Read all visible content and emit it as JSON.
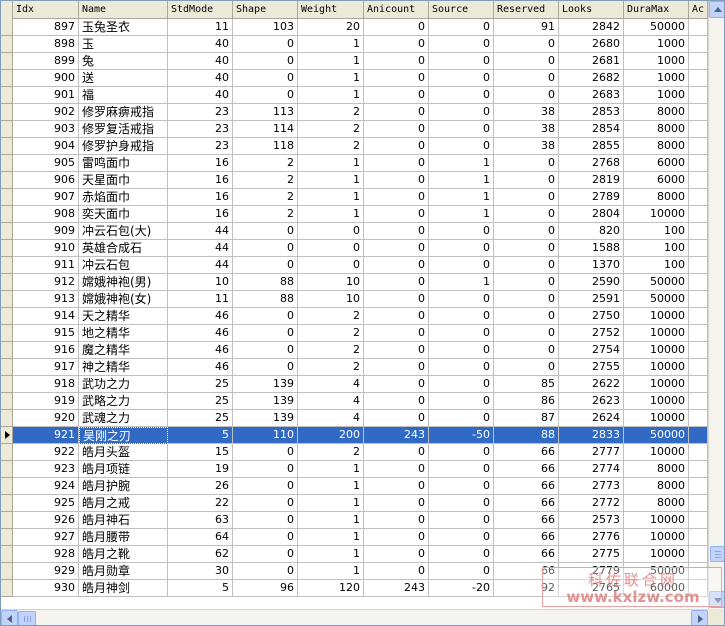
{
  "columns": [
    "Idx",
    "Name",
    "StdMode",
    "Shape",
    "Weight",
    "Anicount",
    "Source",
    "Reserved",
    "Looks",
    "DuraMax",
    "Ac"
  ],
  "selected_idx": "921",
  "rows": [
    [
      "897",
      "玉兔圣衣",
      "11",
      "103",
      "20",
      "0",
      "0",
      "91",
      "2842",
      "50000"
    ],
    [
      "898",
      "玉",
      "40",
      "0",
      "1",
      "0",
      "0",
      "0",
      "2680",
      "1000"
    ],
    [
      "899",
      "兔",
      "40",
      "0",
      "1",
      "0",
      "0",
      "0",
      "2681",
      "1000"
    ],
    [
      "900",
      "送",
      "40",
      "0",
      "1",
      "0",
      "0",
      "0",
      "2682",
      "1000"
    ],
    [
      "901",
      "福",
      "40",
      "0",
      "1",
      "0",
      "0",
      "0",
      "2683",
      "1000"
    ],
    [
      "902",
      "修罗麻痹戒指",
      "23",
      "113",
      "2",
      "0",
      "0",
      "38",
      "2853",
      "8000"
    ],
    [
      "903",
      "修罗复活戒指",
      "23",
      "114",
      "2",
      "0",
      "0",
      "38",
      "2854",
      "8000"
    ],
    [
      "904",
      "修罗护身戒指",
      "23",
      "118",
      "2",
      "0",
      "0",
      "38",
      "2855",
      "8000"
    ],
    [
      "905",
      "雷鸣面巾",
      "16",
      "2",
      "1",
      "0",
      "1",
      "0",
      "2768",
      "6000"
    ],
    [
      "906",
      "天星面巾",
      "16",
      "2",
      "1",
      "0",
      "1",
      "0",
      "2819",
      "6000"
    ],
    [
      "907",
      "赤焰面巾",
      "16",
      "2",
      "1",
      "0",
      "1",
      "0",
      "2789",
      "8000"
    ],
    [
      "908",
      "奕天面巾",
      "16",
      "2",
      "1",
      "0",
      "1",
      "0",
      "2804",
      "10000"
    ],
    [
      "909",
      "冲云石包(大)",
      "44",
      "0",
      "0",
      "0",
      "0",
      "0",
      "820",
      "100"
    ],
    [
      "910",
      "英雄合成石",
      "44",
      "0",
      "0",
      "0",
      "0",
      "0",
      "1588",
      "100"
    ],
    [
      "911",
      "冲云石包",
      "44",
      "0",
      "0",
      "0",
      "0",
      "0",
      "1370",
      "100"
    ],
    [
      "912",
      "嫦娥神袍(男)",
      "10",
      "88",
      "10",
      "0",
      "1",
      "0",
      "2590",
      "50000"
    ],
    [
      "913",
      "嫦娥神袍(女)",
      "11",
      "88",
      "10",
      "0",
      "0",
      "0",
      "2591",
      "50000"
    ],
    [
      "914",
      "天之精华",
      "46",
      "0",
      "2",
      "0",
      "0",
      "0",
      "2750",
      "10000"
    ],
    [
      "915",
      "地之精华",
      "46",
      "0",
      "2",
      "0",
      "0",
      "0",
      "2752",
      "10000"
    ],
    [
      "916",
      "魔之精华",
      "46",
      "0",
      "2",
      "0",
      "0",
      "0",
      "2754",
      "10000"
    ],
    [
      "917",
      "神之精华",
      "46",
      "0",
      "2",
      "0",
      "0",
      "0",
      "2755",
      "10000"
    ],
    [
      "918",
      "武功之力",
      "25",
      "139",
      "4",
      "0",
      "0",
      "85",
      "2622",
      "10000"
    ],
    [
      "919",
      "武略之力",
      "25",
      "139",
      "4",
      "0",
      "0",
      "86",
      "2623",
      "10000"
    ],
    [
      "920",
      "武魂之力",
      "25",
      "139",
      "4",
      "0",
      "0",
      "87",
      "2624",
      "10000"
    ],
    [
      "921",
      "昊刚之刃",
      "5",
      "110",
      "200",
      "243",
      "-50",
      "88",
      "2833",
      "50000"
    ],
    [
      "922",
      "皓月头盔",
      "15",
      "0",
      "2",
      "0",
      "0",
      "66",
      "2777",
      "10000"
    ],
    [
      "923",
      "皓月项链",
      "19",
      "0",
      "1",
      "0",
      "0",
      "66",
      "2774",
      "8000"
    ],
    [
      "924",
      "皓月护腕",
      "26",
      "0",
      "1",
      "0",
      "0",
      "66",
      "2773",
      "8000"
    ],
    [
      "925",
      "皓月之戒",
      "22",
      "0",
      "1",
      "0",
      "0",
      "66",
      "2772",
      "8000"
    ],
    [
      "926",
      "皓月神石",
      "63",
      "0",
      "1",
      "0",
      "0",
      "66",
      "2573",
      "10000"
    ],
    [
      "927",
      "皓月腰带",
      "64",
      "0",
      "1",
      "0",
      "0",
      "66",
      "2776",
      "10000"
    ],
    [
      "928",
      "皓月之靴",
      "62",
      "0",
      "1",
      "0",
      "0",
      "66",
      "2775",
      "10000"
    ],
    [
      "929",
      "皓月勋章",
      "30",
      "0",
      "1",
      "0",
      "0",
      "66",
      "2779",
      "50000"
    ],
    [
      "930",
      "皓月神剑",
      "5",
      "96",
      "120",
      "243",
      "-20",
      "92",
      "2765",
      "60000"
    ]
  ],
  "watermark": {
    "line1": "科佐联合网",
    "line2": "www.kxlzw.com"
  },
  "icons": {
    "row_pointer": "triangle-right-icon",
    "scroll_up": "arrow-up-icon",
    "scroll_down": "arrow-down-icon",
    "scroll_left": "arrow-left-icon",
    "scroll_right": "arrow-right-icon"
  },
  "colors": {
    "selection": "#316ac5",
    "header_bg": "#ece9d8",
    "watermark": "#dc6e6e"
  }
}
